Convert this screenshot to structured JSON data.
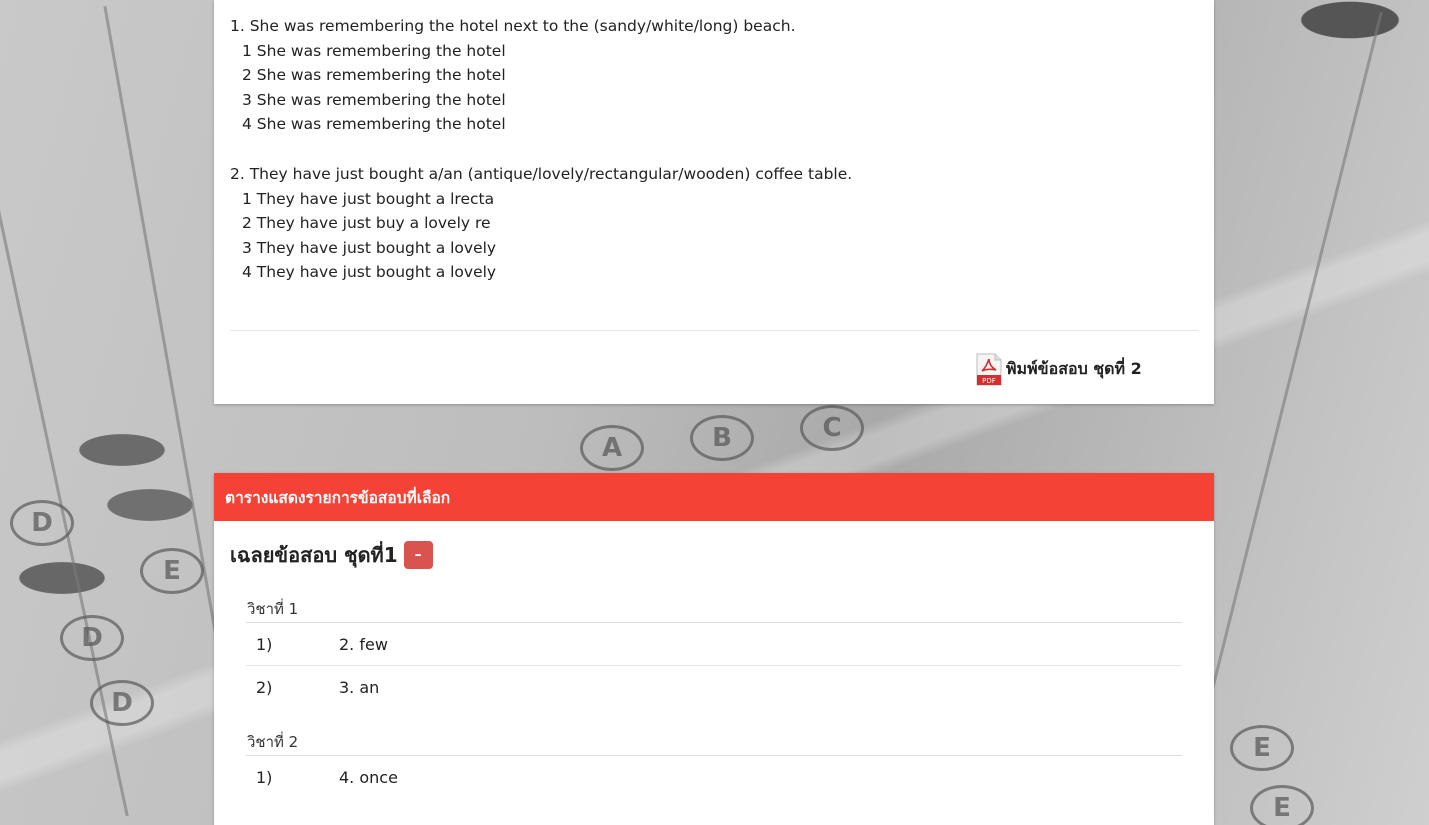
{
  "questions": [
    {
      "text": "1. She was remembering the hotel next to the (sandy/white/long) beach.",
      "options": [
        "1 She was remembering the hotel",
        "2 She was remembering the hotel",
        "3 She was remembering the hotel",
        "4 She was remembering the hotel"
      ]
    },
    {
      "text": "2. They have just bought a/an (antique/lovely/rectangular/wooden) coffee table.",
      "options": [
        "1 They have just bought a lrecta",
        "2 They have just buy a lovely re",
        "3 They have just bought a lovely",
        "4 They have just bought a lovely"
      ]
    }
  ],
  "print_link": {
    "label": "พิมพ์ข้อสอบ ชุดที่ 2",
    "icon": "pdf-icon",
    "icon_text": "PDF"
  },
  "selected_panel": {
    "heading": "ตารางแสดงรายการข้อสอบที่เลือก",
    "answer_title": "เฉลยข้อสอบ ชุดที่1",
    "collapse_label": "–",
    "subjects": [
      {
        "label": "วิชาที่ 1",
        "answers": [
          {
            "no": "1)",
            "value": "2. few"
          },
          {
            "no": "2)",
            "value": "3. an"
          }
        ]
      },
      {
        "label": "วิชาที่ 2",
        "answers": [
          {
            "no": "1)",
            "value": "4. once"
          }
        ]
      }
    ]
  },
  "colors": {
    "heading_bg": "#f44336",
    "collapse_btn": "#d9534f",
    "pdf_red": "#d32f2f"
  }
}
